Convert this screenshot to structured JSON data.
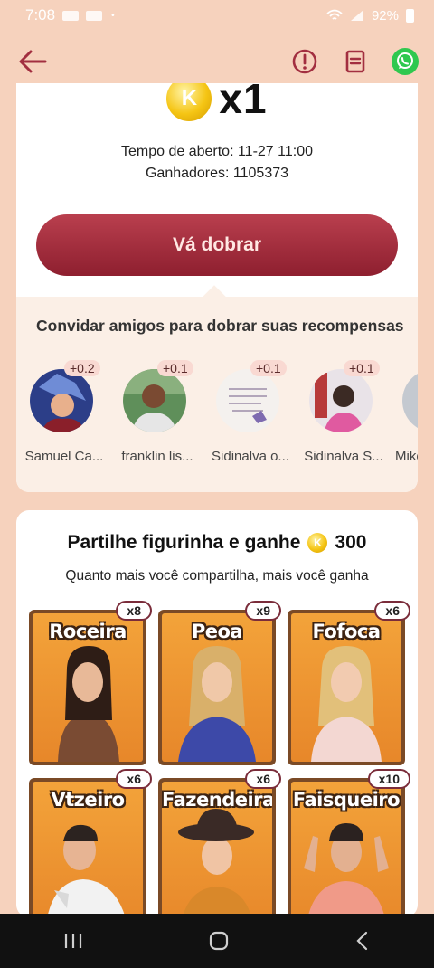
{
  "status_bar": {
    "time": "7:08",
    "dot": "•",
    "battery": "92%"
  },
  "header": {
    "back_icon": "arrow-left-icon",
    "report_icon": "exclamation-circle-icon",
    "notes_icon": "document-icon",
    "whatsapp_icon": "whatsapp-icon"
  },
  "reward": {
    "coin_letter": "K",
    "multiplier": "x1",
    "open_time": "Tempo de aberto: 11-27 11:00",
    "winners": "Ganhadores: 1105373",
    "double_button": "Vá dobrar"
  },
  "invite": {
    "title": "Convidar amigos para dobrar suas recompensas",
    "friends": [
      {
        "name": "Samuel Ca...",
        "bonus": "+0.2"
      },
      {
        "name": "franklin lis...",
        "bonus": "+0.1"
      },
      {
        "name": "Sidinalva o...",
        "bonus": "+0.1"
      },
      {
        "name": "Sidinalva S...",
        "bonus": "+0.1"
      },
      {
        "name": "Mike"
      }
    ]
  },
  "share": {
    "title_prefix": "Partilhe figurinha e ganhe",
    "coin_letter": "K",
    "amount": "300",
    "subtitle": "Quanto mais você compartilha, mais você ganha",
    "stickers": [
      {
        "name": "Roceira",
        "count": "x8"
      },
      {
        "name": "Peoa",
        "count": "x9"
      },
      {
        "name": "Fofoca",
        "count": "x6"
      },
      {
        "name": "Vtzeiro",
        "count": "x6"
      },
      {
        "name": "Fazendeira",
        "count": "x6"
      },
      {
        "name": "Faisqueiro",
        "count": "x10"
      }
    ]
  },
  "colors": {
    "background": "#f6d2bd",
    "accent": "#a22f40",
    "sticker_orange": "#f0972f"
  }
}
